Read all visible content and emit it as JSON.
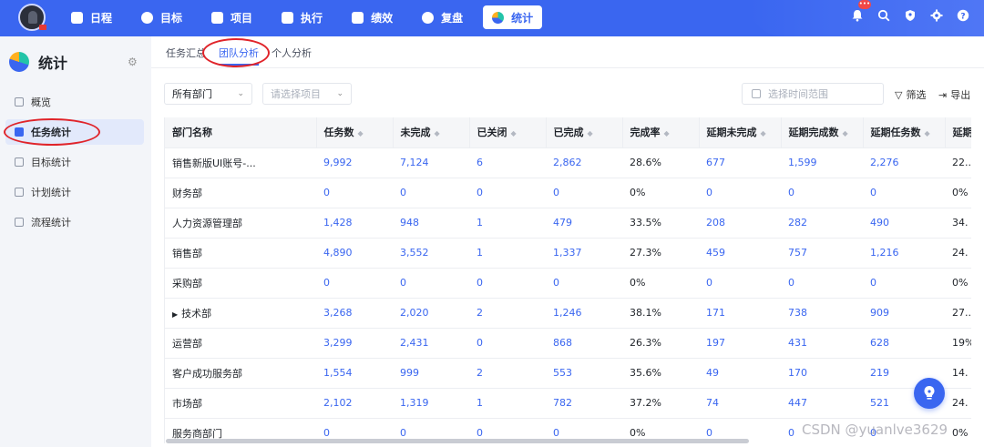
{
  "topnav": {
    "items": [
      {
        "label": "日程",
        "icon": "calendar-icon"
      },
      {
        "label": "目标",
        "icon": "target-icon"
      },
      {
        "label": "项目",
        "icon": "box-icon"
      },
      {
        "label": "执行",
        "icon": "list-icon"
      },
      {
        "label": "绩效",
        "icon": "chart-icon"
      },
      {
        "label": "复盘",
        "icon": "review-icon"
      },
      {
        "label": "统计",
        "icon": "pie-icon"
      }
    ],
    "active": "统计",
    "bell_badge": "•••"
  },
  "sidebar": {
    "title": "统计",
    "items": [
      {
        "label": "概览"
      },
      {
        "label": "任务统计"
      },
      {
        "label": "目标统计"
      },
      {
        "label": "计划统计"
      },
      {
        "label": "流程统计"
      }
    ],
    "active": "任务统计"
  },
  "tabs": [
    {
      "label": "任务汇总"
    },
    {
      "label": "团队分析"
    },
    {
      "label": "个人分析"
    }
  ],
  "active_tab": "团队分析",
  "filters": {
    "department": "所有部门",
    "project_placeholder": "请选择项目",
    "date_placeholder": "选择时间范围",
    "filter_label": "筛选",
    "export_label": "导出"
  },
  "table": {
    "columns": [
      "部门名称",
      "任务数",
      "未完成",
      "已关闭",
      "已完成",
      "完成率",
      "延期未完成",
      "延期完成数",
      "延期任务数",
      "延期"
    ],
    "rows": [
      [
        "销售新版UI账号-...",
        "9,992",
        "7,124",
        "6",
        "2,862",
        "28.6%",
        "677",
        "1,599",
        "2,276",
        "22.."
      ],
      [
        "财务部",
        "0",
        "0",
        "0",
        "0",
        "0%",
        "0",
        "0",
        "0",
        "0%"
      ],
      [
        "人力资源管理部",
        "1,428",
        "948",
        "1",
        "479",
        "33.5%",
        "208",
        "282",
        "490",
        "34."
      ],
      [
        "销售部",
        "4,890",
        "3,552",
        "1",
        "1,337",
        "27.3%",
        "459",
        "757",
        "1,216",
        "24."
      ],
      [
        "采购部",
        "0",
        "0",
        "0",
        "0",
        "0%",
        "0",
        "0",
        "0",
        "0%"
      ],
      [
        "技术部",
        "3,268",
        "2,020",
        "2",
        "1,246",
        "38.1%",
        "171",
        "738",
        "909",
        "27.."
      ],
      [
        "运营部",
        "3,299",
        "2,431",
        "0",
        "868",
        "26.3%",
        "197",
        "431",
        "628",
        "19%"
      ],
      [
        "客户成功服务部",
        "1,554",
        "999",
        "2",
        "553",
        "35.6%",
        "49",
        "170",
        "219",
        "14."
      ],
      [
        "市场部",
        "2,102",
        "1,319",
        "1",
        "782",
        "37.2%",
        "74",
        "447",
        "521",
        "24."
      ],
      [
        "服务商部门",
        "0",
        "0",
        "0",
        "0",
        "0%",
        "0",
        "0",
        "0",
        "0%"
      ]
    ]
  },
  "watermark": "CSDN @yuanlve3629"
}
